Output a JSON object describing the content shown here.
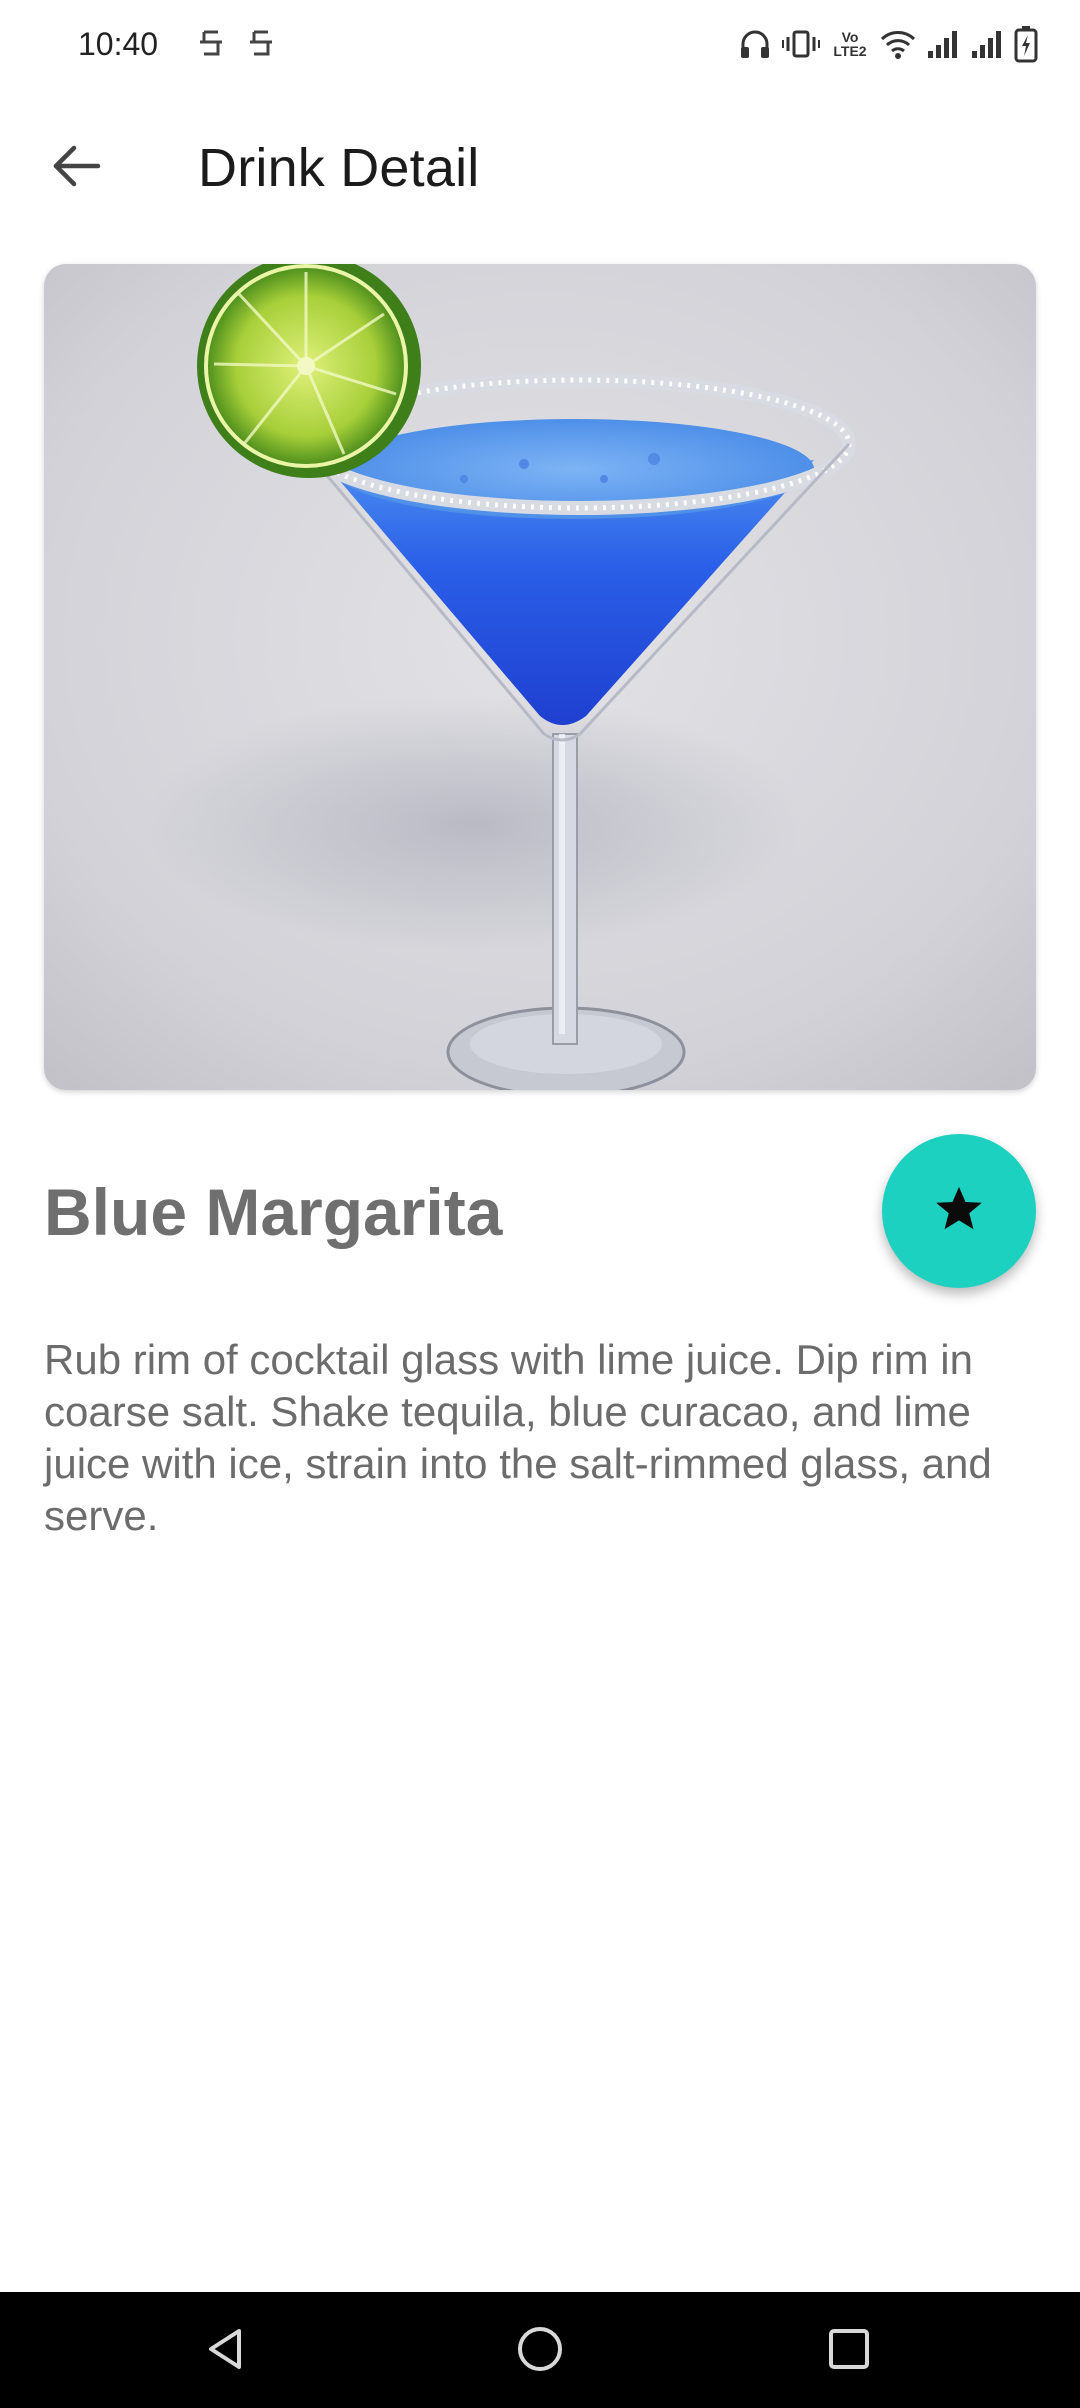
{
  "status_bar": {
    "time": "10:40",
    "icons": [
      "notification-app-icon",
      "notification-app-icon",
      "headphones-icon",
      "vibrate-icon",
      "volte-icon",
      "wifi-icon",
      "signal-icon",
      "signal-icon",
      "battery-charging-icon"
    ],
    "volte_label_top": "Vo",
    "volte_label_bottom": "LTE2"
  },
  "app_bar": {
    "back_icon": "arrow-back-icon",
    "title": "Drink Detail"
  },
  "drink": {
    "image_alt": "blue-margarita-cocktail-photo",
    "name": "Blue Margarita",
    "instructions": "Rub rim of cocktail glass with lime juice. Dip rim in coarse salt. Shake tequila, blue curacao, and lime juice with ice, strain into the salt-rimmed glass, and serve."
  },
  "fab": {
    "icon": "star-icon",
    "color": "#1dd1c1"
  },
  "nav_bar": {
    "buttons": [
      "back-triangle-icon",
      "home-circle-icon",
      "recents-square-icon"
    ]
  }
}
